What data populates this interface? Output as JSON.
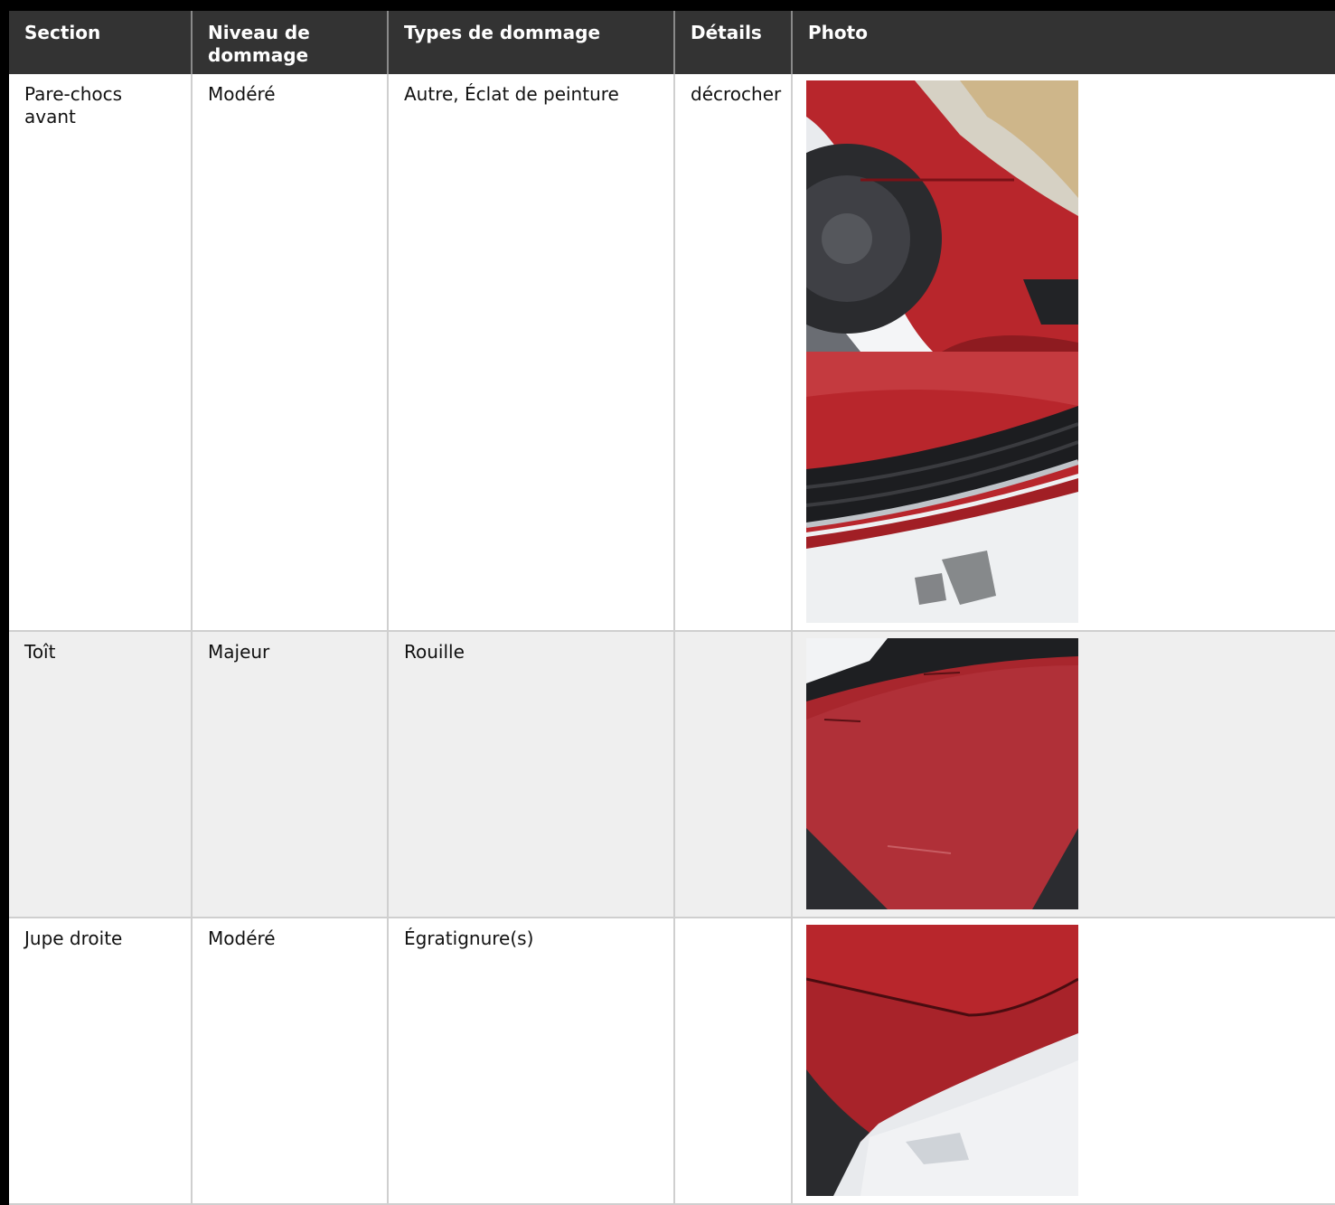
{
  "table": {
    "headers": {
      "section": "Section",
      "niveau": "Niveau de dommage",
      "types": "Types de dommage",
      "details": "Détails",
      "photo": "Photo"
    },
    "rows": [
      {
        "section": "Pare-chocs avant",
        "niveau": "Modéré",
        "types": "Autre, Éclat de peinture",
        "details": "décrocher"
      },
      {
        "section": "Toît",
        "niveau": "Majeur",
        "types": "Rouille",
        "details": ""
      },
      {
        "section": "Jupe droite",
        "niveau": "Modéré",
        "types": "Égratignure(s)",
        "details": ""
      }
    ]
  },
  "colors": {
    "header_bg": "#333333",
    "header_text": "#ffffff",
    "alt_row_bg": "#efefef",
    "grid_line": "#cfcfcf",
    "car_red": "#b8262c"
  }
}
